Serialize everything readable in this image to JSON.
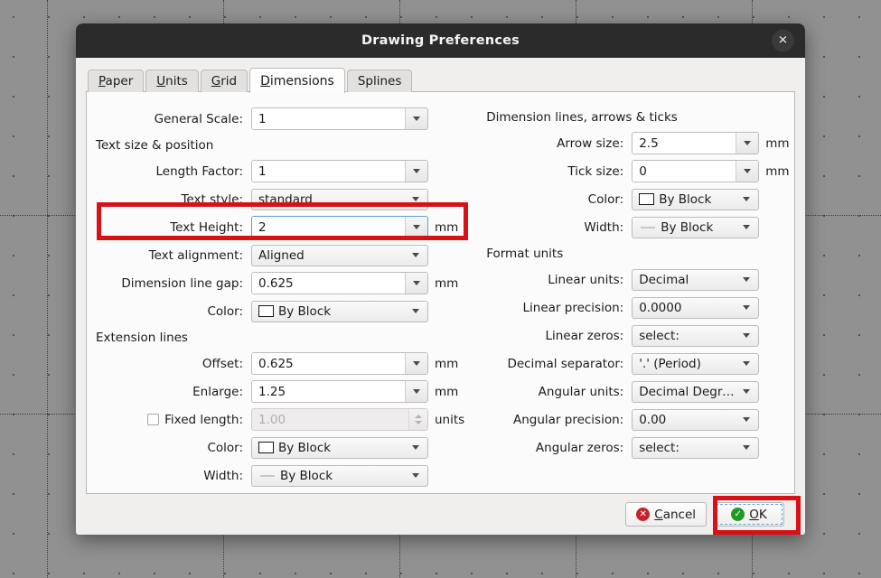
{
  "window": {
    "title": "Drawing Preferences",
    "close_icon": "close-icon",
    "close_glyph": "✕"
  },
  "tabs": [
    {
      "label": "Paper",
      "mnemonic": "P",
      "active": false
    },
    {
      "label": "Units",
      "mnemonic": "U",
      "active": false
    },
    {
      "label": "Grid",
      "mnemonic": "G",
      "active": false
    },
    {
      "label": "Dimensions",
      "mnemonic": "D",
      "active": true
    },
    {
      "label": "Splines",
      "mnemonic": "",
      "active": false
    }
  ],
  "left_column": {
    "general_scale": {
      "label": "General Scale:",
      "value": "1",
      "unit": ""
    },
    "section_text": {
      "title": "Text size & position"
    },
    "length_factor": {
      "label": "Length Factor:",
      "value": "1",
      "unit": ""
    },
    "text_style": {
      "label": "Text style:",
      "value": "standard"
    },
    "text_height": {
      "label": "Text Height:",
      "value": "2",
      "unit": "mm",
      "highlighted": true
    },
    "text_alignment": {
      "label": "Text alignment:",
      "value": "Aligned"
    },
    "dim_line_gap": {
      "label": "Dimension line gap:",
      "value": "0.625",
      "unit": "mm"
    },
    "text_color": {
      "label": "Color:",
      "value": "By Block",
      "swatch": "color-swatch"
    },
    "section_ext": {
      "title": "Extension lines"
    },
    "offset": {
      "label": "Offset:",
      "value": "0.625",
      "unit": "mm"
    },
    "enlarge": {
      "label": "Enlarge:",
      "value": "1.25",
      "unit": "mm"
    },
    "fixed_length": {
      "label": "Fixed length:",
      "value": "1.00",
      "unit": "units",
      "checked": false,
      "disabled": true
    },
    "ext_color": {
      "label": "Color:",
      "value": "By Block",
      "swatch": "color-swatch"
    },
    "ext_width": {
      "label": "Width:",
      "value": "By Block",
      "swatch": "line-swatch"
    }
  },
  "right_column": {
    "section_dim": {
      "title": "Dimension lines, arrows & ticks"
    },
    "arrow_size": {
      "label": "Arrow size:",
      "value": "2.5",
      "unit": "mm"
    },
    "tick_size": {
      "label": "Tick size:",
      "value": "0",
      "unit": "mm"
    },
    "dim_color": {
      "label": "Color:",
      "value": "By Block",
      "swatch": "color-swatch"
    },
    "dim_width": {
      "label": "Width:",
      "value": "By Block",
      "swatch": "line-swatch"
    },
    "section_format": {
      "title": "Format units"
    },
    "linear_units": {
      "label": "Linear units:",
      "value": "Decimal"
    },
    "linear_precision": {
      "label": "Linear precision:",
      "value": "0.0000"
    },
    "linear_zeros": {
      "label": "Linear zeros:",
      "value": "select:"
    },
    "decimal_separator": {
      "label": "Decimal separator:",
      "value": "'.' (Period)"
    },
    "angular_units": {
      "label": "Angular units:",
      "value": "Decimal Degrees"
    },
    "angular_precision": {
      "label": "Angular precision:",
      "value": "0.00"
    },
    "angular_zeros": {
      "label": "Angular zeros:",
      "value": "select:"
    }
  },
  "actions": {
    "cancel": {
      "label": "Cancel",
      "mnemonic": "C",
      "icon": "error-circle-icon",
      "glyph": "✕"
    },
    "ok": {
      "label": "OK",
      "mnemonic": "O",
      "icon": "check-circle-icon",
      "glyph": "✓",
      "focused": true,
      "highlighted": true
    }
  },
  "annotations": {
    "color": "#d81116",
    "boxes": [
      "text-height-row",
      "ok-button"
    ]
  }
}
